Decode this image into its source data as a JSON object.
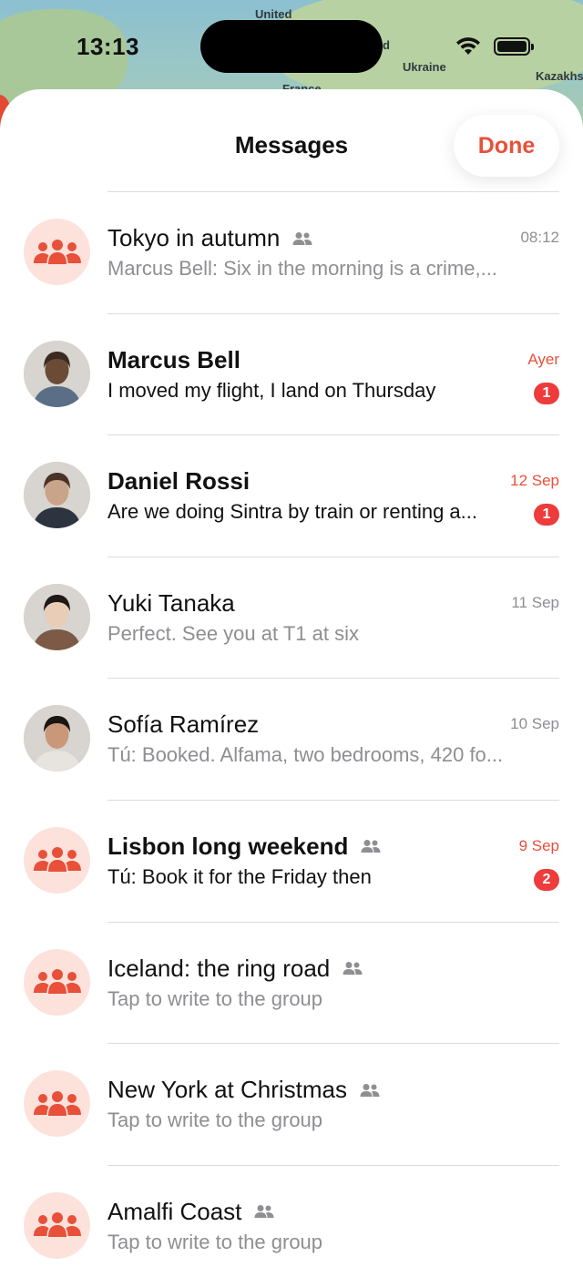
{
  "status_bar": {
    "time": "13:13"
  },
  "map": {
    "labels": [
      "United",
      "Ukraine",
      "Kazakhs",
      "France",
      "d"
    ]
  },
  "sheet": {
    "title": "Messages",
    "done_label": "Done"
  },
  "colors": {
    "accent": "#e8503a",
    "badge": "#ee3b3b",
    "group_bg": "#fde2dc",
    "secondary_text": "#8e8e93"
  },
  "conversations": [
    {
      "title": "Tokyo in autumn",
      "is_group": true,
      "time": "08:12",
      "preview": "Marcus Bell: Six in the morning is a crime,...",
      "unread": false,
      "badge": "",
      "avatar": "group-icon"
    },
    {
      "title": "Marcus Bell",
      "is_group": false,
      "time": "Ayer",
      "preview": "I moved my flight, I land on Thursday",
      "unread": true,
      "badge": "1",
      "avatar": "photo-marcus"
    },
    {
      "title": "Daniel Rossi",
      "is_group": false,
      "time": "12 Sep",
      "preview": "Are we doing Sintra by train or renting a...",
      "unread": true,
      "badge": "1",
      "avatar": "photo-daniel"
    },
    {
      "title": "Yuki Tanaka",
      "is_group": false,
      "time": "11 Sep",
      "preview": "Perfect. See you at T1 at six",
      "unread": false,
      "badge": "",
      "avatar": "photo-yuki"
    },
    {
      "title": "Sofía Ramírez",
      "is_group": false,
      "time": "10 Sep",
      "preview": "Tú: Booked. Alfama, two bedrooms, 420 fo...",
      "unread": false,
      "badge": "",
      "avatar": "photo-sofia"
    },
    {
      "title": "Lisbon long weekend",
      "is_group": true,
      "time": "9 Sep",
      "preview": "Tú: Book it for the Friday then",
      "unread": true,
      "badge": "2",
      "avatar": "group-icon"
    },
    {
      "title": "Iceland: the ring road",
      "is_group": true,
      "time": "",
      "preview": "Tap to write to the group",
      "unread": false,
      "badge": "",
      "avatar": "group-icon"
    },
    {
      "title": "New York at Christmas",
      "is_group": true,
      "time": "",
      "preview": "Tap to write to the group",
      "unread": false,
      "badge": "",
      "avatar": "group-icon"
    },
    {
      "title": "Amalfi Coast",
      "is_group": true,
      "time": "",
      "preview": "Tap to write to the group",
      "unread": false,
      "badge": "",
      "avatar": "group-icon"
    }
  ]
}
